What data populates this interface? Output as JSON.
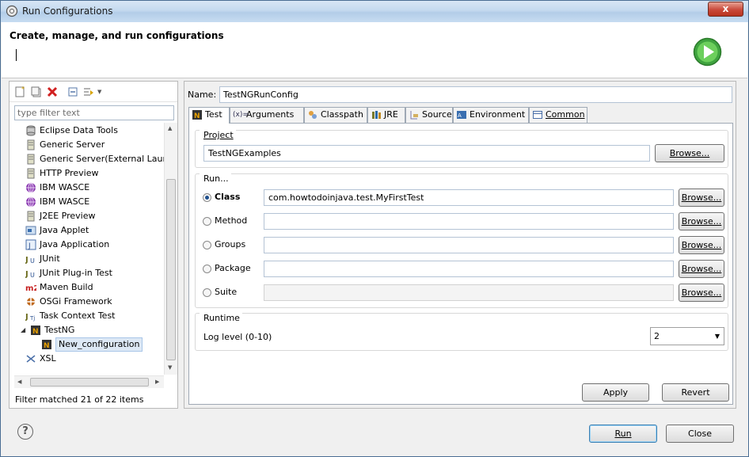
{
  "window": {
    "title": "Run Configurations",
    "close_glyph": "x"
  },
  "header": {
    "title": "Create, manage, and run configurations"
  },
  "left": {
    "filter_placeholder": "type filter text",
    "tree": [
      {
        "label": "Eclipse Data Tools",
        "icon": "database-icon"
      },
      {
        "label": "Generic Server",
        "icon": "server-icon"
      },
      {
        "label": "Generic Server(External Laun",
        "icon": "server-icon"
      },
      {
        "label": "HTTP Preview",
        "icon": "server-icon"
      },
      {
        "label": "IBM WASCE",
        "icon": "globe-icon"
      },
      {
        "label": "IBM WASCE",
        "icon": "globe-icon"
      },
      {
        "label": "J2EE Preview",
        "icon": "server-icon"
      },
      {
        "label": "Java Applet",
        "icon": "applet-icon"
      },
      {
        "label": "Java Application",
        "icon": "java-app-icon"
      },
      {
        "label": "JUnit",
        "icon": "junit-icon"
      },
      {
        "label": "JUnit Plug-in Test",
        "icon": "junit-plugin-icon"
      },
      {
        "label": "Maven Build",
        "icon": "maven-icon"
      },
      {
        "label": "OSGi Framework",
        "icon": "osgi-icon"
      },
      {
        "label": "Task Context Test",
        "icon": "task-context-icon"
      },
      {
        "label": "TestNG",
        "icon": "testng-icon"
      },
      {
        "label": "New_configuration",
        "icon": "testng-icon"
      },
      {
        "label": "XSL",
        "icon": "xsl-icon"
      }
    ],
    "filter_status": "Filter matched 21 of 22 items"
  },
  "right": {
    "name_label": "Name:",
    "name_value": "TestNGRunConfig",
    "tabs": [
      "Test",
      "Arguments",
      "Classpath",
      "JRE",
      "Source",
      "Environment",
      "Common"
    ],
    "project": {
      "title": "Project",
      "value": "TestNGExamples",
      "browse": "Browse..."
    },
    "run": {
      "title": "Run...",
      "options": [
        {
          "label": "Class",
          "value": "com.howtodoinjava.test.MyFirstTest",
          "checked": true
        },
        {
          "label": "Method",
          "value": "",
          "checked": false
        },
        {
          "label": "Groups",
          "value": "",
          "checked": false
        },
        {
          "label": "Package",
          "value": "",
          "checked": false
        },
        {
          "label": "Suite",
          "value": "",
          "checked": false
        }
      ],
      "browse": "Browse..."
    },
    "runtime": {
      "title": "Runtime",
      "log_label": "Log level (0-10)",
      "log_value": "2"
    },
    "apply": "Apply",
    "revert": "Revert"
  },
  "footer": {
    "run": "Run",
    "close": "Close",
    "help_glyph": "?"
  }
}
